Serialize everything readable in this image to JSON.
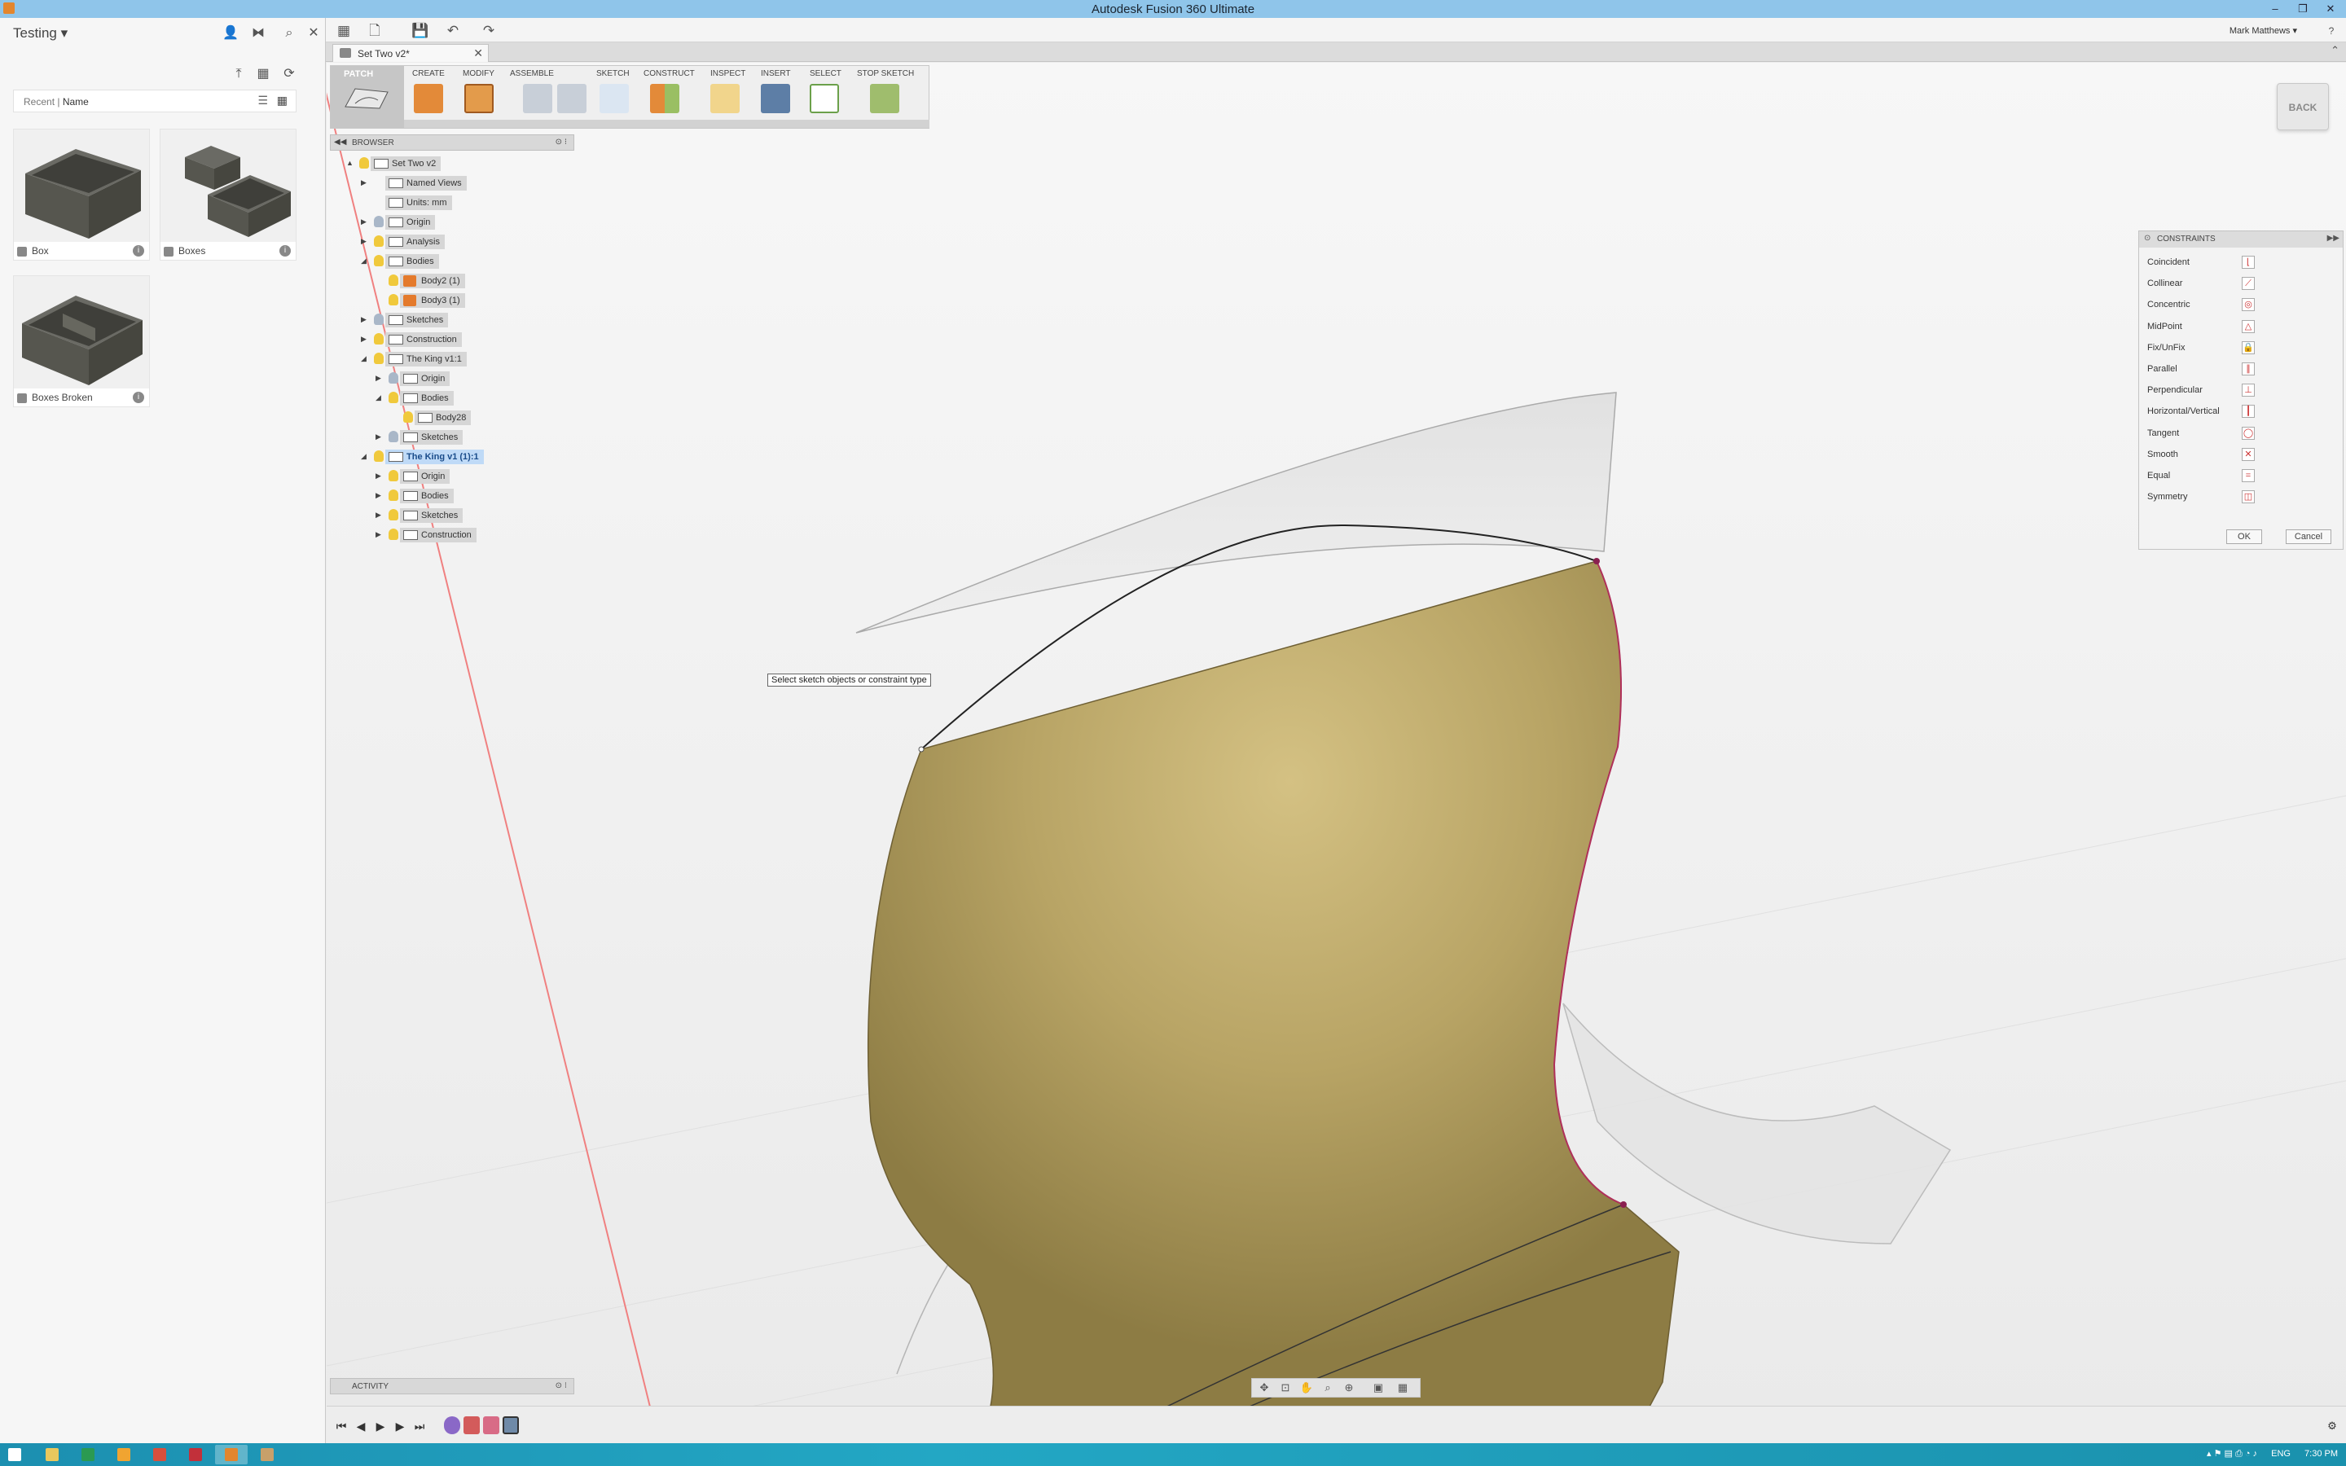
{
  "window": {
    "title": "Autodesk Fusion 360 Ultimate"
  },
  "app_toolbar": {
    "user": "Mark Matthews ▾"
  },
  "data_panel": {
    "project": "Testing ▾",
    "sort": {
      "recent": "Recent",
      "name": "Name"
    },
    "items": [
      {
        "name": "Box"
      },
      {
        "name": "Boxes"
      },
      {
        "name": "Boxes Broken"
      }
    ]
  },
  "document_tab": {
    "title": "Set Two v2*"
  },
  "ribbon": {
    "workspace": "PATCH",
    "groups": [
      "CREATE",
      "MODIFY",
      "ASSEMBLE",
      "SKETCH",
      "CONSTRUCT",
      "INSPECT",
      "INSERT",
      "SELECT",
      "STOP SKETCH"
    ]
  },
  "browser": {
    "title": "BROWSER",
    "rows": [
      {
        "label": "Set Two v2",
        "level": 0,
        "bulb": true,
        "icon": "doc",
        "expand": "▲"
      },
      {
        "label": "Named Views",
        "level": 1,
        "bulb": false,
        "icon": "folder",
        "expand": "▶"
      },
      {
        "label": "Units: mm",
        "level": 1,
        "bulb": false,
        "icon": "doc",
        "expand": ""
      },
      {
        "label": "Origin",
        "level": 1,
        "bulb": "off",
        "icon": "folder",
        "expand": "▶"
      },
      {
        "label": "Analysis",
        "level": 1,
        "bulb": true,
        "icon": "folder",
        "expand": "▶"
      },
      {
        "label": "Bodies",
        "level": 1,
        "bulb": true,
        "icon": "folder",
        "expand": "◢"
      },
      {
        "label": "Body2 (1)",
        "level": 2,
        "bulb": true,
        "icon": "comp",
        "expand": ""
      },
      {
        "label": "Body3 (1)",
        "level": 2,
        "bulb": true,
        "icon": "comp",
        "expand": ""
      },
      {
        "label": "Sketches",
        "level": 1,
        "bulb": "off",
        "icon": "folder",
        "expand": "▶"
      },
      {
        "label": "Construction",
        "level": 1,
        "bulb": true,
        "icon": "folder",
        "expand": "▶"
      },
      {
        "label": "The King v1:1",
        "level": 1,
        "bulb": true,
        "icon": "doc",
        "expand": "◢"
      },
      {
        "label": "Origin",
        "level": 2,
        "bulb": "off",
        "icon": "folder",
        "expand": "▶"
      },
      {
        "label": "Bodies",
        "level": 2,
        "bulb": true,
        "icon": "folder",
        "expand": "◢"
      },
      {
        "label": "Body28",
        "level": 3,
        "bulb": true,
        "icon": "doc",
        "expand": ""
      },
      {
        "label": "Sketches",
        "level": 2,
        "bulb": "off",
        "icon": "folder",
        "expand": "▶"
      },
      {
        "label": "The King v1 (1):1",
        "level": 1,
        "bulb": true,
        "icon": "doc",
        "expand": "◢",
        "active": true
      },
      {
        "label": "Origin",
        "level": 2,
        "bulb": true,
        "icon": "folder",
        "expand": "▶"
      },
      {
        "label": "Bodies",
        "level": 2,
        "bulb": true,
        "icon": "folder",
        "expand": "▶"
      },
      {
        "label": "Sketches",
        "level": 2,
        "bulb": true,
        "icon": "folder",
        "expand": "▶"
      },
      {
        "label": "Construction",
        "level": 2,
        "bulb": true,
        "icon": "folder",
        "expand": "▶"
      }
    ]
  },
  "constraints": {
    "title": "CONSTRAINTS",
    "items": [
      {
        "label": "Coincident",
        "glyph": "⌊"
      },
      {
        "label": "Collinear",
        "glyph": "⟋"
      },
      {
        "label": "Concentric",
        "glyph": "◎"
      },
      {
        "label": "MidPoint",
        "glyph": "△"
      },
      {
        "label": "Fix/UnFix",
        "glyph": "🔒"
      },
      {
        "label": "Parallel",
        "glyph": "∥"
      },
      {
        "label": "Perpendicular",
        "glyph": "⊥"
      },
      {
        "label": "Horizontal/Vertical",
        "glyph": "┃"
      },
      {
        "label": "Tangent",
        "glyph": "◯"
      },
      {
        "label": "Smooth",
        "glyph": "✕"
      },
      {
        "label": "Equal",
        "glyph": "="
      },
      {
        "label": "Symmetry",
        "glyph": "◫"
      }
    ],
    "ok": "OK",
    "cancel": "Cancel"
  },
  "tooltip": "Select sketch objects or constraint type",
  "back_button": "BACK",
  "activity": "ACTIVITY",
  "taskbar": {
    "lang": "ENG",
    "time": "7:30 PM"
  },
  "colors": {
    "titlebar": "#8fc5ea",
    "body": "#b19e5e",
    "highlight": "#bfdaf7",
    "taskbar": "#1c8fb0"
  }
}
